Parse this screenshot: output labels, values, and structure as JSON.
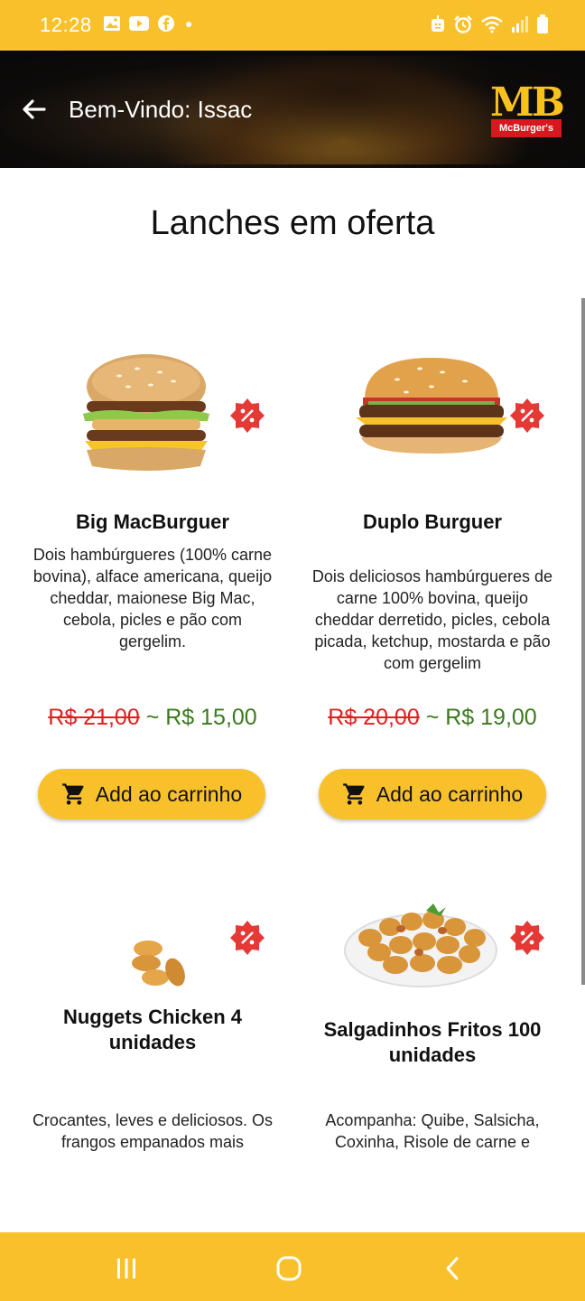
{
  "status_bar": {
    "time": "12:28",
    "left_icons": [
      "gallery-icon",
      "youtube-icon",
      "facebook-icon",
      "dot-icon"
    ],
    "right_icons": [
      "notification-icon",
      "alarm-icon",
      "wifi-icon",
      "signal-icon",
      "battery-icon"
    ]
  },
  "header": {
    "back_icon": "arrow-left-icon",
    "title": "Bem-Vindo: Issac",
    "logo_letters": "MB",
    "logo_tag": "McBurger's"
  },
  "page": {
    "title": "Lanches em oferta"
  },
  "products": [
    {
      "name": "Big MacBurguer",
      "description": "Dois hambúrgueres (100% carne bovina), alface americana, queijo cheddar, maionese Big Mac, cebola, picles e pão com gergelim.",
      "old_price": "R$ 21,00",
      "separator": "~",
      "new_price": "R$ 15,00",
      "button_label": "Add ao carrinho"
    },
    {
      "name": "Duplo Burguer",
      "description": "Dois deliciosos hambúrgueres de carne 100% bovina, queijo cheddar derretido, picles, cebola picada, ketchup, mostarda e pão com gergelim",
      "old_price": "R$ 20,00",
      "separator": "~",
      "new_price": "R$ 19,00",
      "button_label": "Add ao carrinho"
    },
    {
      "name": "Nuggets Chicken 4 unidades",
      "description": "Crocantes, leves e deliciosos. Os frangos empanados mais"
    },
    {
      "name": "Salgadinhos Fritos 100 unidades",
      "description": "Acompanha: Quibe, Salsicha, Coxinha, Risole de carne e"
    }
  ],
  "colors": {
    "accent": "#f8c12c",
    "old_price": "#e0201f",
    "new_price": "#3a7a1c",
    "offer_badge": "#e53935"
  },
  "nav": {
    "recents_icon": "recents-icon",
    "home_icon": "home-icon",
    "back_icon": "back-nav-icon"
  }
}
